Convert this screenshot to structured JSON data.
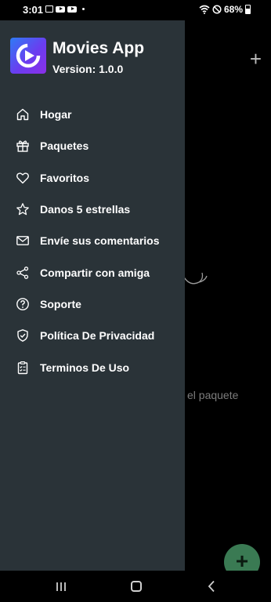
{
  "status_bar": {
    "time": "3:01",
    "battery": "68%"
  },
  "drawer": {
    "app_name": "Movies App",
    "version": "Version: 1.0.0",
    "items": [
      {
        "label": "Hogar",
        "icon": "home-icon"
      },
      {
        "label": "Paquetes",
        "icon": "gift-icon"
      },
      {
        "label": "Favoritos",
        "icon": "heart-icon"
      },
      {
        "label": "Danos 5 estrellas",
        "icon": "star-icon"
      },
      {
        "label": "Envíe sus comentarios",
        "icon": "mail-icon"
      },
      {
        "label": "Compartir con amiga",
        "icon": "share-icon"
      },
      {
        "label": "Soporte",
        "icon": "help-icon"
      },
      {
        "label": "Política De Privacidad",
        "icon": "shield-icon"
      },
      {
        "label": "Terminos De Uso",
        "icon": "clipboard-icon"
      }
    ]
  },
  "background": {
    "empty_text": "el paquete",
    "add_button": "+",
    "fab": "+"
  },
  "colors": {
    "drawer_bg": "#2a3338",
    "fab_bg": "#3a7a53",
    "logo_gradient_start": "#2f7bf5",
    "logo_gradient_end": "#8b2fe8"
  }
}
